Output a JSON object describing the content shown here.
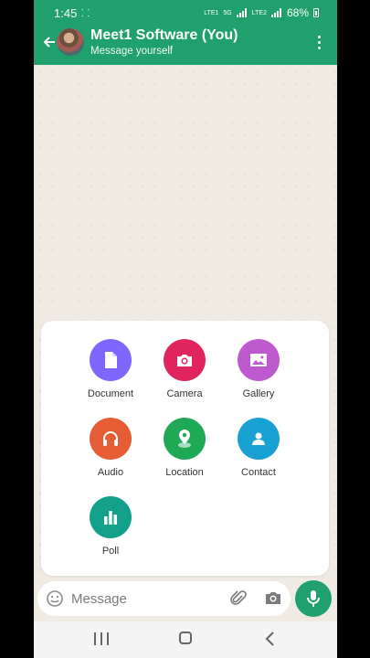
{
  "status_bar": {
    "time": "1:45",
    "extra": "⸬",
    "battery": "68%",
    "network1": "LTE1",
    "network2": "LTE2",
    "speed": "5G"
  },
  "header": {
    "title": "Meet1 Software (You)",
    "subtitle": "Message yourself"
  },
  "attach_menu": {
    "items": [
      {
        "label": "Document",
        "icon": "document-icon",
        "color": "#7f66ff"
      },
      {
        "label": "Camera",
        "icon": "camera-icon",
        "color": "#e0245e"
      },
      {
        "label": "Gallery",
        "icon": "gallery-icon",
        "color": "#bf59cf"
      },
      {
        "label": "Audio",
        "icon": "headphones-icon",
        "color": "#e65c34"
      },
      {
        "label": "Location",
        "icon": "location-icon",
        "color": "#1fa855"
      },
      {
        "label": "Contact",
        "icon": "contact-icon",
        "color": "#1aa1d4"
      },
      {
        "label": "Poll",
        "icon": "poll-icon",
        "color": "#12a08a"
      }
    ]
  },
  "composer": {
    "placeholder": "Message"
  },
  "colors": {
    "accent": "#1fa06c",
    "background": "#efeae2"
  }
}
